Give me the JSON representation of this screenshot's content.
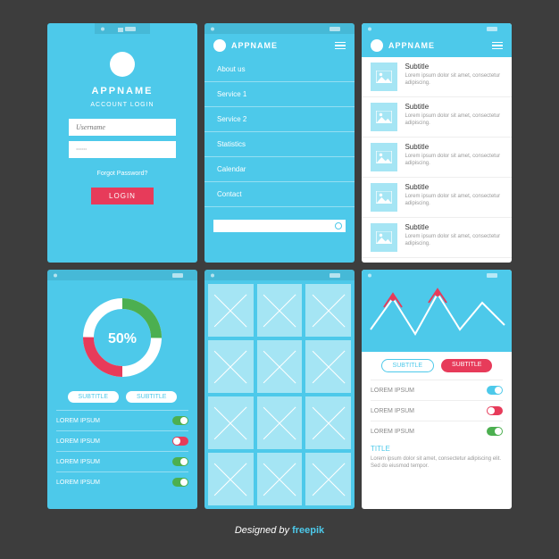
{
  "app": {
    "name": "APPNAME"
  },
  "login": {
    "title": "APPNAME",
    "subtitle": "ACCOUNT LOGIN",
    "username_ph": "Username",
    "password_ph": "······",
    "forgot": "Forgot Password?",
    "button": "LOGIN"
  },
  "menu": {
    "items": [
      "About us",
      "Service 1",
      "Service 2",
      "Statistics",
      "Calendar",
      "Contact"
    ]
  },
  "list": {
    "subtitle": "Subtitle",
    "lorem": "Lorem ipsum dolor sit amet, consectetur adipiscing."
  },
  "donut": {
    "percent": "50%",
    "pill1": "Subtitle",
    "pill2": "Subtitle",
    "rows": [
      {
        "label": "Lorem ipsum",
        "on": true,
        "color": "green"
      },
      {
        "label": "Lorem ipsum",
        "on": false,
        "color": "red"
      },
      {
        "label": "Lorem ipsum",
        "on": true,
        "color": "green"
      },
      {
        "label": "Lorem ipsum",
        "on": true,
        "color": "green"
      }
    ]
  },
  "chart": {
    "pill1": "SUBTITLE",
    "pill2": "SUBTITLE",
    "rows": [
      {
        "label": "Lorem ipsum",
        "on": true,
        "color": "cyan"
      },
      {
        "label": "Lorem ipsum",
        "on": false,
        "color": "red"
      },
      {
        "label": "Lorem ipsum",
        "on": true,
        "color": "green"
      }
    ],
    "title_label": "TITLE",
    "lorem": "Lorem ipsum dolor sit amet, consectetur adipiscing elit. Sed do eiusmod tempor."
  },
  "chart_data": {
    "type": "line",
    "x": [
      0,
      1,
      2,
      3,
      4,
      5,
      6
    ],
    "series": [
      {
        "name": "white",
        "values": [
          30,
          65,
          20,
          70,
          25,
          60,
          35
        ],
        "color": "#ffffff"
      },
      {
        "name": "red-peaks",
        "values": [
          null,
          70,
          null,
          75,
          null,
          null,
          null
        ],
        "color": "#e73b5a"
      }
    ],
    "ylim": [
      0,
      80
    ]
  },
  "credit": {
    "prefix": "Designed by ",
    "brand": "freepik"
  }
}
